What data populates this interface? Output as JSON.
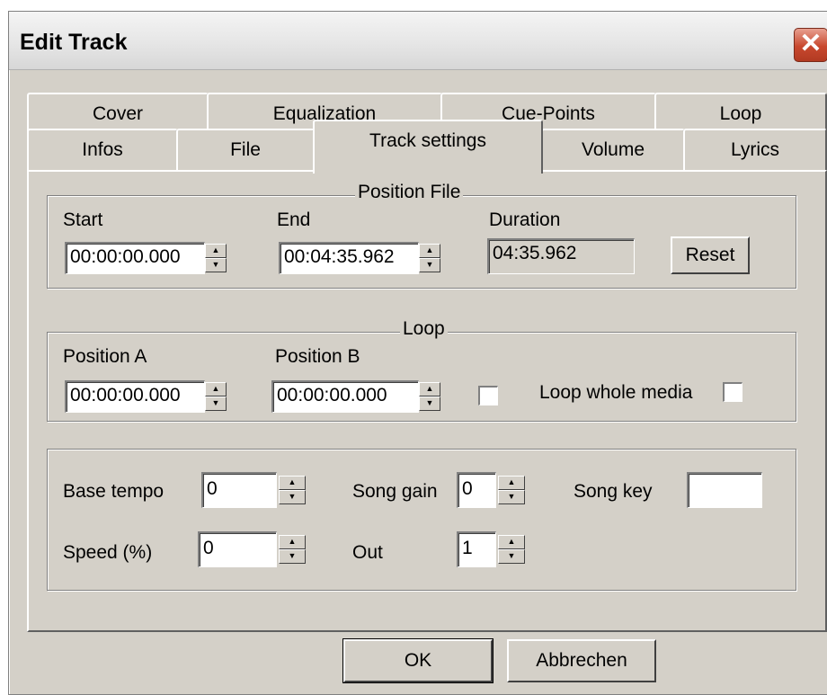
{
  "window": {
    "title": "Edit Track",
    "close_glyph": "✕"
  },
  "tabs_row1": [
    "Cover",
    "Equalization",
    "Cue-Points",
    "Loop"
  ],
  "tabs_row2": [
    "Infos",
    "File",
    "Track settings",
    "Volume",
    "Lyrics"
  ],
  "active_tab": "Track settings",
  "position_file": {
    "title": "Position File",
    "start_label": "Start",
    "start_value": "00:00:00.000",
    "end_label": "End",
    "end_value": "00:04:35.962",
    "duration_label": "Duration",
    "duration_value": "04:35.962",
    "reset_label": "Reset"
  },
  "loop": {
    "title": "Loop",
    "pos_a_label": "Position A",
    "pos_a_value": "00:00:00.000",
    "pos_b_label": "Position B",
    "pos_b_value": "00:00:00.000",
    "loop_whole_label": "Loop whole media"
  },
  "settings": {
    "base_tempo_label": "Base tempo",
    "base_tempo_value": "0",
    "song_gain_label": "Song gain",
    "song_gain_value": "0",
    "song_key_label": "Song key",
    "song_key_value": "",
    "speed_label": "Speed (%)",
    "speed_value": "0",
    "out_label": "Out",
    "out_value": "1"
  },
  "buttons": {
    "ok": "OK",
    "cancel": "Abbrechen"
  },
  "colors": {
    "face": "#d4d0c8",
    "close": "#c8482e"
  }
}
